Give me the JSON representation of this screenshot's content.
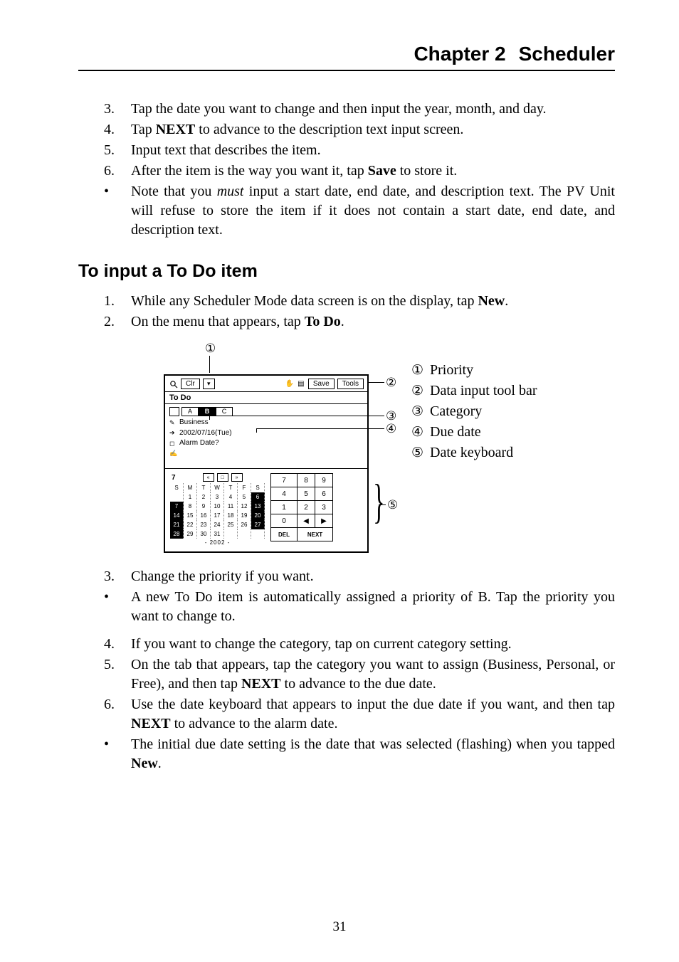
{
  "chapter": {
    "num": "Chapter 2",
    "title": "Scheduler"
  },
  "list1": {
    "i3": {
      "num": "3.",
      "text_a": "Tap the date you want to change and then input the year, month, and day."
    },
    "i4": {
      "num": "4.",
      "text_a": "Tap ",
      "b": "NEXT",
      "text_b": " to advance to the description text input screen."
    },
    "i5": {
      "num": "5.",
      "text_a": "Input text that describes the item."
    },
    "i6": {
      "num": "6.",
      "text_a": "After the item is the way you want it, tap ",
      "b": "Save",
      "text_b": " to store it."
    },
    "bullet1": {
      "marker": "•",
      "text_a": "Note that you ",
      "i": "must",
      "text_b": " input a start date, end date, and description text. The PV Unit will refuse to store the item if it does not contain a start date, end date, and description text."
    }
  },
  "heading": "To input a To Do item",
  "list2": {
    "i1": {
      "num": "1.",
      "text_a": "While any Scheduler Mode data screen is on the display, tap ",
      "b": "New",
      "text_b": "."
    },
    "i2": {
      "num": "2.",
      "text_a": "On the menu that appears, tap ",
      "b": "To Do",
      "text_b": "."
    }
  },
  "callouts": {
    "c1": {
      "num": "①",
      "label": "Priority"
    },
    "c2": {
      "num": "②",
      "label": "Data input tool bar"
    },
    "c3": {
      "num": "③",
      "label": "Category"
    },
    "c4": {
      "num": "④",
      "label": "Due date"
    },
    "c5": {
      "num": "⑤",
      "label": "Date keyboard"
    }
  },
  "device": {
    "toolbar": {
      "clr": "Clr",
      "save": "Save",
      "tools": "Tools"
    },
    "title": "To Do",
    "abc": {
      "a": "A",
      "b": "B",
      "c": "C"
    },
    "body": {
      "business": "Business",
      "date": "2002/07/16(Tue)",
      "alarm": "Alarm  Date?"
    },
    "cal": {
      "month_num": "7",
      "head": [
        "S",
        "M",
        "T",
        "W",
        "T",
        "F",
        "S"
      ],
      "rows": [
        [
          "",
          "1",
          "2",
          "3",
          "4",
          "5",
          "6"
        ],
        [
          "7",
          "8",
          "9",
          "10",
          "11",
          "12",
          "13"
        ],
        [
          "14",
          "15",
          "16",
          "17",
          "18",
          "19",
          "20"
        ],
        [
          "21",
          "22",
          "23",
          "24",
          "25",
          "26",
          "27"
        ],
        [
          "28",
          "29",
          "30",
          "31",
          "",
          "",
          ""
        ]
      ],
      "year": "- 2002 -"
    },
    "numpad": {
      "r1": [
        "7",
        "8",
        "9"
      ],
      "r2": [
        "4",
        "5",
        "6"
      ],
      "r3": [
        "1",
        "2",
        "3"
      ],
      "r4": [
        "0",
        "◀",
        "▶"
      ],
      "r5": [
        "DEL",
        "NEXT"
      ]
    }
  },
  "list3": {
    "i3": {
      "num": "3.",
      "text": "Change the priority if you want."
    },
    "bullet1": {
      "marker": "•",
      "text": "A new To Do item is automatically assigned a priority of B. Tap the priority you want to change to."
    },
    "i4": {
      "num": "4.",
      "text": "If you want to change the category, tap on current category setting."
    },
    "i5": {
      "num": "5.",
      "text_a": "On the tab that appears, tap the category you want to assign (Business, Personal, or Free), and then tap ",
      "b": "NEXT",
      "text_b": " to advance to the due date."
    },
    "i6": {
      "num": "6.",
      "text_a": "Use the date keyboard that appears to input the due date if you want, and then tap ",
      "b": "NEXT",
      "text_b": " to advance to the alarm date."
    },
    "bullet2": {
      "marker": "•",
      "text_a": "The initial due date setting is the date that was selected (flashing) when you tapped ",
      "b": "New",
      "text_b": "."
    }
  },
  "page_number": "31"
}
